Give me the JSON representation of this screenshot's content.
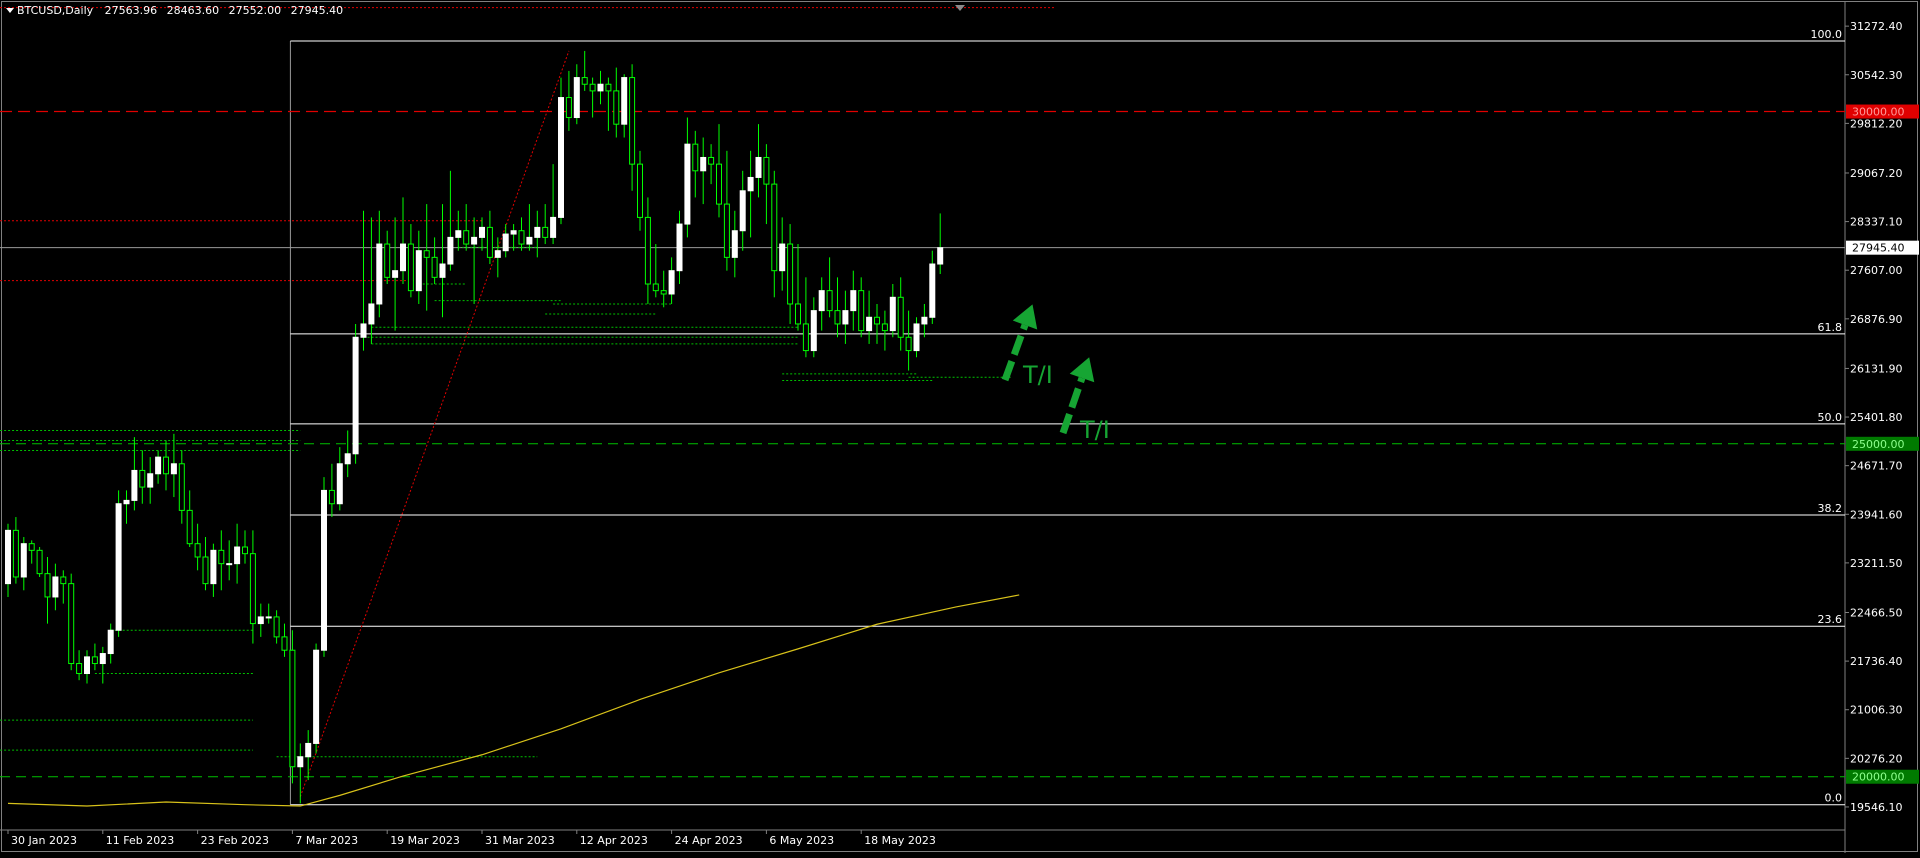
{
  "header": {
    "symbol": "BTCUSD,Daily",
    "open": "27563.96",
    "high": "28463.60",
    "low": "27552.00",
    "close": "27945.40"
  },
  "colors": {
    "background": "#000000",
    "border": "#808080",
    "bull": "#ffffff",
    "wick": "#00ff00",
    "fib": "#ffffff",
    "ma": "#d8c21a",
    "support": "#00c000",
    "resistance": "#e00000",
    "arrow": "#16a533",
    "text": "#ffffff"
  },
  "chart_data": {
    "type": "candlestick",
    "symbol": "BTCUSD",
    "timeframe": "Daily",
    "ylim": [
      19200,
      31620
    ],
    "y_ticks": [
      "31272.40",
      "30542.30",
      "29812.20",
      "29067.20",
      "28337.10",
      "27607.00",
      "26876.90",
      "26131.90",
      "25401.80",
      "24671.70",
      "23941.60",
      "23211.50",
      "22466.50",
      "21736.40",
      "21006.30",
      "20276.20",
      "19546.10"
    ],
    "x_ticks": [
      "30 Jan 2023",
      "11 Feb 2023",
      "23 Feb 2023",
      "7 Mar 2023",
      "19 Mar 2023",
      "31 Mar 2023",
      "12 Apr 2023",
      "24 Apr 2023",
      "6 May 2023",
      "18 May 2023"
    ],
    "x_tick_index": [
      0,
      12,
      24,
      36,
      48,
      60,
      72,
      84,
      96,
      108
    ],
    "current_price": "27945.40",
    "candles": [
      [
        22900,
        23800,
        22700,
        23700
      ],
      [
        23700,
        23900,
        22900,
        23000
      ],
      [
        23000,
        23600,
        22800,
        23500
      ],
      [
        23500,
        23550,
        23200,
        23400
      ],
      [
        23400,
        23450,
        23000,
        23050
      ],
      [
        23050,
        23300,
        22300,
        22700
      ],
      [
        22700,
        23200,
        22500,
        23000
      ],
      [
        23000,
        23100,
        22600,
        22900
      ],
      [
        22900,
        23050,
        21600,
        21700
      ],
      [
        21700,
        21900,
        21450,
        21550
      ],
      [
        21550,
        21900,
        21400,
        21800
      ],
      [
        21800,
        22000,
        21600,
        21700
      ],
      [
        21700,
        21950,
        21400,
        21850
      ],
      [
        21850,
        22300,
        21700,
        22200
      ],
      [
        22200,
        24300,
        22100,
        24100
      ],
      [
        24100,
        24300,
        23800,
        24150
      ],
      [
        24150,
        25100,
        24000,
        24600
      ],
      [
        24600,
        24900,
        24100,
        24350
      ],
      [
        24350,
        24800,
        24100,
        24550
      ],
      [
        24550,
        24900,
        24400,
        24800
      ],
      [
        24800,
        25050,
        24300,
        24550
      ],
      [
        24550,
        25150,
        24200,
        24700
      ],
      [
        24700,
        24900,
        23800,
        24000
      ],
      [
        24000,
        24300,
        23450,
        23500
      ],
      [
        23500,
        23800,
        23100,
        23300
      ],
      [
        23300,
        23600,
        22800,
        22900
      ],
      [
        22900,
        23500,
        22700,
        23400
      ],
      [
        23400,
        23700,
        22800,
        23200
      ],
      [
        23200,
        23550,
        22950,
        23200
      ],
      [
        23200,
        23800,
        22900,
        23450
      ],
      [
        23450,
        23700,
        23200,
        23350
      ],
      [
        23350,
        23700,
        22000,
        22300
      ],
      [
        22300,
        22600,
        22100,
        22400
      ],
      [
        22400,
        22600,
        22300,
        22400
      ],
      [
        22400,
        22500,
        22000,
        22100
      ],
      [
        22100,
        22300,
        21800,
        21900
      ],
      [
        21900,
        22200,
        19900,
        20150
      ],
      [
        20150,
        20500,
        19600,
        20300
      ],
      [
        20300,
        20700,
        19950,
        20500
      ],
      [
        20500,
        22000,
        20350,
        21900
      ],
      [
        21900,
        24500,
        21800,
        24300
      ],
      [
        24300,
        24700,
        23900,
        24100
      ],
      [
        24100,
        24950,
        24000,
        24700
      ],
      [
        24700,
        25200,
        24500,
        24850
      ],
      [
        24850,
        26800,
        24700,
        26600
      ],
      [
        26600,
        28500,
        26400,
        26800
      ],
      [
        26800,
        28400,
        26500,
        27100
      ],
      [
        27100,
        28500,
        26900,
        28000
      ],
      [
        28000,
        28200,
        27400,
        27500
      ],
      [
        27500,
        28400,
        26700,
        27600
      ],
      [
        27600,
        28700,
        27400,
        28000
      ],
      [
        28000,
        28300,
        27200,
        27300
      ],
      [
        27300,
        28200,
        27100,
        27900
      ],
      [
        27900,
        28600,
        27000,
        27800
      ],
      [
        27800,
        28100,
        27400,
        27500
      ],
      [
        27500,
        28600,
        26900,
        27700
      ],
      [
        27700,
        29100,
        27600,
        28100
      ],
      [
        28100,
        28500,
        27900,
        28200
      ],
      [
        28200,
        28600,
        27900,
        28000
      ],
      [
        28000,
        28400,
        27100,
        28100
      ],
      [
        28100,
        28400,
        27900,
        28250
      ],
      [
        28250,
        28500,
        27700,
        27800
      ],
      [
        27800,
        28100,
        27500,
        27900
      ],
      [
        27900,
        28300,
        27800,
        28150
      ],
      [
        28150,
        28300,
        27900,
        28200
      ],
      [
        28200,
        28400,
        27900,
        28000
      ],
      [
        28000,
        28600,
        27900,
        28100
      ],
      [
        28100,
        28500,
        27800,
        28250
      ],
      [
        28250,
        28600,
        28000,
        28100
      ],
      [
        28100,
        29200,
        28000,
        28400
      ],
      [
        28400,
        30500,
        28300,
        30200
      ],
      [
        30200,
        30600,
        29700,
        29900
      ],
      [
        29900,
        30700,
        29800,
        30500
      ],
      [
        30500,
        30900,
        30300,
        30400
      ],
      [
        30400,
        30500,
        29900,
        30300
      ],
      [
        30300,
        30600,
        30100,
        30400
      ],
      [
        30400,
        30500,
        29700,
        30300
      ],
      [
        30300,
        30650,
        29600,
        29800
      ],
      [
        29800,
        30550,
        29600,
        30500
      ],
      [
        30500,
        30700,
        28800,
        29200
      ],
      [
        29200,
        29400,
        28200,
        28400
      ],
      [
        28400,
        28700,
        27100,
        27400
      ],
      [
        27400,
        28000,
        27200,
        27300
      ],
      [
        27300,
        27600,
        27050,
        27250
      ],
      [
        27250,
        27800,
        27100,
        27600
      ],
      [
        27600,
        28500,
        27400,
        28300
      ],
      [
        28300,
        29900,
        28100,
        29500
      ],
      [
        29500,
        29700,
        28700,
        29100
      ],
      [
        29100,
        29600,
        28600,
        29300
      ],
      [
        29300,
        29500,
        28900,
        29200
      ],
      [
        29200,
        29800,
        28400,
        28600
      ],
      [
        28600,
        29400,
        27600,
        27800
      ],
      [
        27800,
        28500,
        27500,
        28200
      ],
      [
        28200,
        29100,
        27900,
        28800
      ],
      [
        28800,
        29400,
        28100,
        29000
      ],
      [
        29000,
        29800,
        28700,
        29300
      ],
      [
        29300,
        29500,
        28300,
        28900
      ],
      [
        28900,
        29100,
        27200,
        27600
      ],
      [
        27600,
        28400,
        27300,
        28000
      ],
      [
        28000,
        28300,
        26800,
        27100
      ],
      [
        27100,
        28000,
        26700,
        26800
      ],
      [
        26800,
        27500,
        26300,
        26400
      ],
      [
        26400,
        27200,
        26300,
        27000
      ],
      [
        27000,
        27500,
        26700,
        27300
      ],
      [
        27300,
        27800,
        26900,
        27000
      ],
      [
        27000,
        27500,
        26600,
        26800
      ],
      [
        26800,
        27300,
        26500,
        27000
      ],
      [
        27000,
        27600,
        26700,
        27300
      ],
      [
        27300,
        27500,
        26600,
        26700
      ],
      [
        26700,
        27300,
        26500,
        26900
      ],
      [
        26900,
        27100,
        26500,
        26800
      ],
      [
        26800,
        27000,
        26400,
        26700
      ],
      [
        26700,
        27400,
        26600,
        27200
      ],
      [
        27200,
        27500,
        26400,
        26600
      ],
      [
        26600,
        27000,
        26100,
        26400
      ],
      [
        26400,
        26900,
        26300,
        26800
      ],
      [
        26800,
        27100,
        26600,
        26900
      ],
      [
        26900,
        27900,
        26800,
        27700
      ],
      [
        27700,
        28460,
        27550,
        27945
      ]
    ],
    "ma": [
      [
        0,
        19600
      ],
      [
        10,
        19560
      ],
      [
        20,
        19620
      ],
      [
        30,
        19580
      ],
      [
        37,
        19560
      ],
      [
        42,
        19720
      ],
      [
        50,
        20010
      ],
      [
        60,
        20330
      ],
      [
        70,
        20720
      ],
      [
        80,
        21160
      ],
      [
        90,
        21560
      ],
      [
        100,
        21920
      ],
      [
        110,
        22290
      ],
      [
        120,
        22550
      ],
      [
        128,
        22730
      ]
    ],
    "fib_levels": [
      {
        "label": "100.0",
        "price": 31050
      },
      {
        "label": "61.8",
        "price": 26650
      },
      {
        "label": "50.0",
        "price": 25300
      },
      {
        "label": "38.2",
        "price": 23930
      },
      {
        "label": "23.6",
        "price": 22260
      },
      {
        "label": "0.0",
        "price": 19580
      }
    ],
    "price_labels": [
      {
        "text": "30000.00",
        "price": 29990,
        "style": "red"
      },
      {
        "text": "25000.00",
        "price": 25000,
        "style": "green"
      },
      {
        "text": "20000.00",
        "price": 20000,
        "style": "green"
      }
    ],
    "annotations": [
      {
        "text": "T/I"
      },
      {
        "text": "T/I"
      }
    ]
  }
}
